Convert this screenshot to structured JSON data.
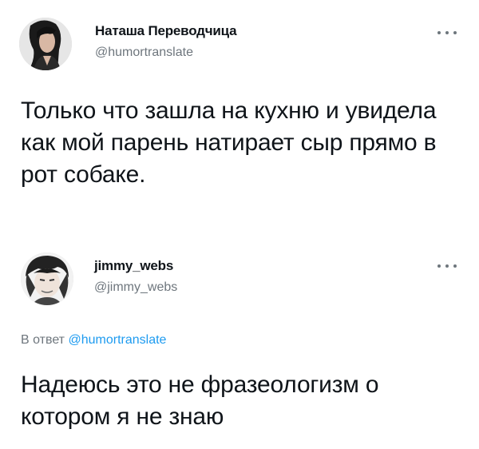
{
  "tweets": [
    {
      "display_name": "Наташа Переводчица",
      "handle": "@humortranslate",
      "text": "Только что зашла на кухню и увидела как мой парень натирает сыр прямо в рот собаке.",
      "avatar_icon": "user-avatar-photo",
      "more_icon": "more-options-icon"
    },
    {
      "display_name": "jimmy_webs",
      "handle": "@jimmy_webs",
      "reply_prefix": "В ответ",
      "reply_mention": "@humortranslate",
      "text": "Надеюсь это не фразеологизм о котором я не знаю",
      "avatar_icon": "user-avatar-photo",
      "more_icon": "more-options-icon"
    }
  ],
  "colors": {
    "text": "#0f1419",
    "secondary": "#6e767d",
    "link": "#1d9bf0",
    "background": "#ffffff"
  }
}
